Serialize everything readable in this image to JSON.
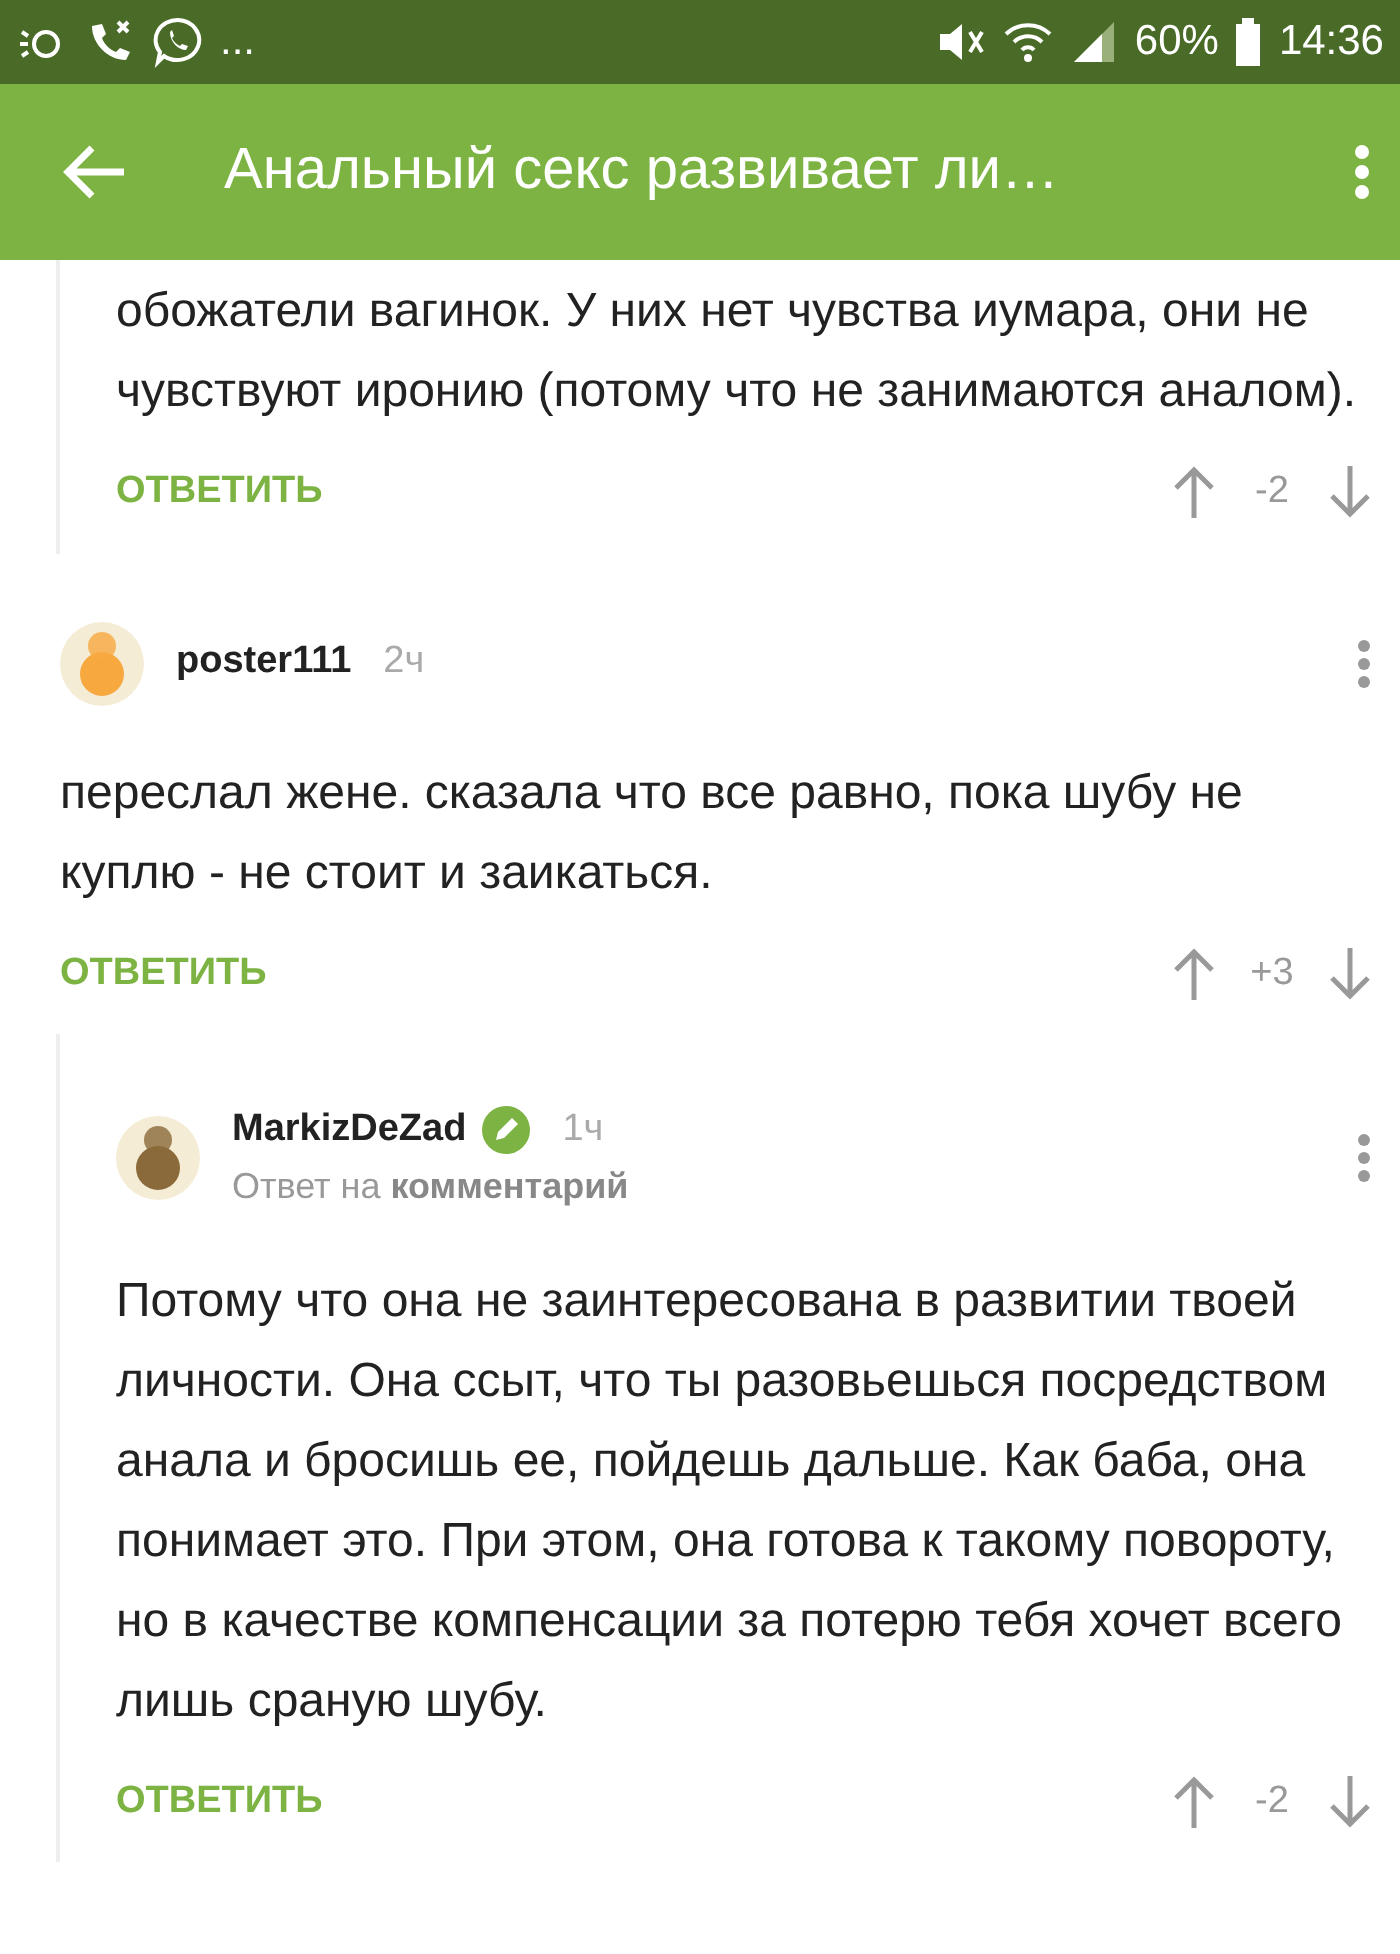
{
  "status_bar": {
    "notifications": "...",
    "battery": "60%",
    "time": "14:36"
  },
  "app_bar": {
    "title": "Анальный секс развивает ли…"
  },
  "comments": [
    {
      "nested": true,
      "text": "обожатели вагинок. У них нет чувства иумара, они не чувствуют иронию (потому что не занимаются аналом).",
      "reply_label": "ОТВЕТИТЬ",
      "rating": "-2"
    },
    {
      "nested": false,
      "author": "poster111",
      "time": "2ч",
      "author_badge": false,
      "text": "переслал жене. сказала что все равно, пока шубу не куплю - не стоит и заикаться.",
      "reply_label": "ОТВЕТИТЬ",
      "rating": "+3"
    },
    {
      "nested": true,
      "author": "MarkizDeZad",
      "time": "1ч",
      "author_badge": true,
      "reply_to": "Ответ на **комментарий**",
      "text": "Потому что она не заинтересована в развитии твоей личности. Она ссыт, что ты разовьешься посредством анала и бросишь ее, пойдешь дальше. Как баба, она понимает это. При этом, она готова к такому повороту, но в качестве компенсации за потерю тебя хочет всего лишь сраную шубу.",
      "reply_label": "ОТВЕТИТЬ",
      "rating": "-2"
    }
  ]
}
